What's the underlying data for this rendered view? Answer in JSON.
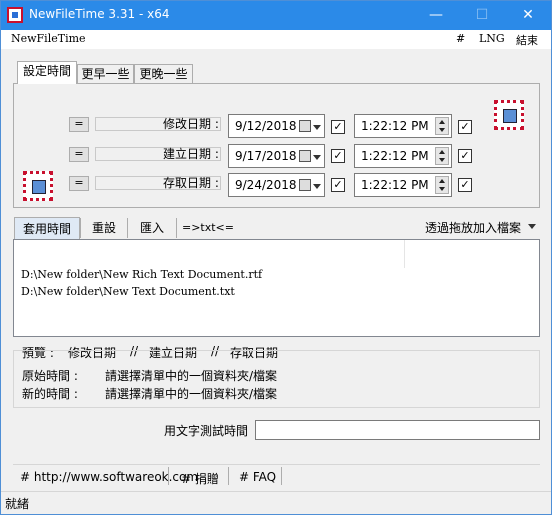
{
  "window": {
    "title": "NewFileTime 3.31 - x64"
  },
  "titlebar": {
    "minimize": "—",
    "maximize": "☐",
    "close": "✕"
  },
  "menu": {
    "app": "NewFileTime",
    "hash": "#",
    "lng": "LNG",
    "exit": "結束"
  },
  "tabs": [
    "設定時間",
    "更早一些",
    "更晚一些"
  ],
  "rows": [
    {
      "eq": "=",
      "label": "修改日期 :",
      "date": "9/12/2018",
      "time": "1:22:12 PM",
      "date_checked": true,
      "time_checked": true
    },
    {
      "eq": "=",
      "label": "建立日期 :",
      "date": "9/17/2018",
      "time": "1:22:12 PM",
      "date_checked": true,
      "time_checked": true
    },
    {
      "eq": "=",
      "label": "存取日期 :",
      "date": "9/24/2018",
      "time": "1:22:12 PM",
      "date_checked": true,
      "time_checked": true
    }
  ],
  "toolbar": {
    "apply": "套用時間",
    "reset": "重設",
    "import": "匯入",
    "txt": "=>txt<=",
    "dragdrop": "透過拖放加入檔案"
  },
  "files": [
    "D:\\New folder\\New Rich Text Document.rtf",
    "D:\\New folder\\New Text Document.txt"
  ],
  "preview": {
    "label": "預覽 :",
    "col1": "修改日期",
    "sep1": "//",
    "col2": "建立日期",
    "sep2": "//",
    "col3": "存取日期",
    "original_label": "原始時間 :",
    "original_value": "請選擇清單中的一個資料夾/檔案",
    "new_label": "新的時間 :",
    "new_value": "請選擇清單中的一個資料夾/檔案"
  },
  "test_text": {
    "label": "用文字測試時間",
    "value": ""
  },
  "footer": {
    "website": "# http://www.softwareok.com",
    "donate": "# 捐贈",
    "faq": "# FAQ"
  },
  "status": "就緒"
}
